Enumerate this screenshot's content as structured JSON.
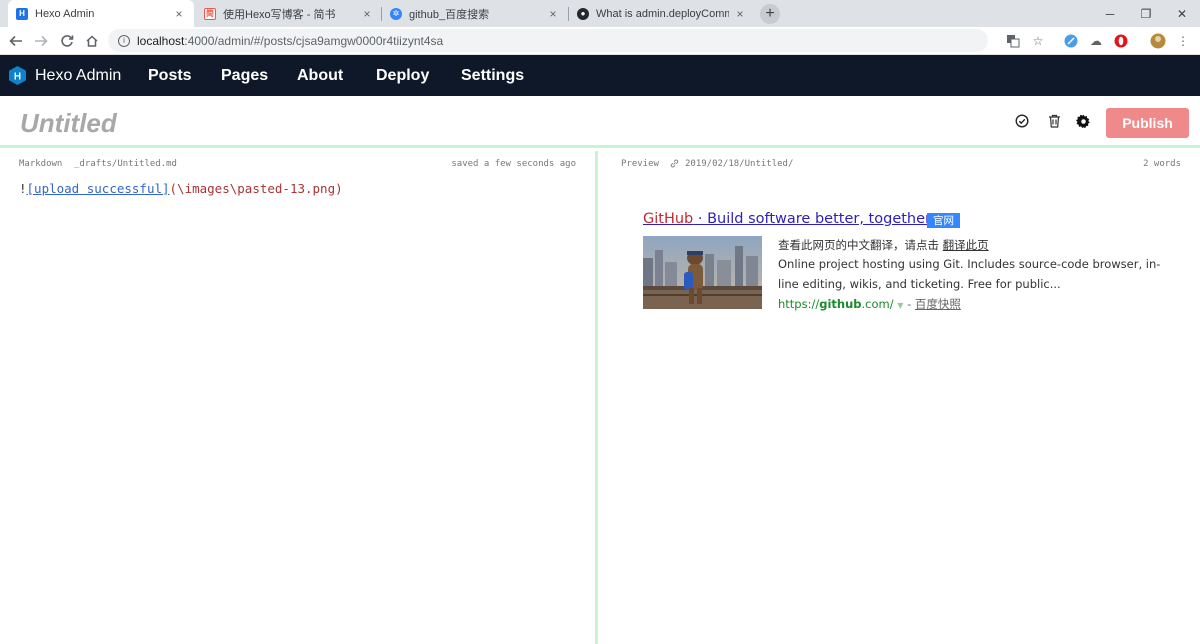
{
  "browser": {
    "tabs": [
      {
        "title": "Hexo Admin",
        "icon": "hexo-favicon-icon",
        "color": "#1e73e8"
      },
      {
        "title": "使用Hexo写博客 - 简书",
        "icon": "jianshu-favicon-icon",
        "color": "#e8594b"
      },
      {
        "title": "github_百度搜索",
        "icon": "baidu-favicon-icon",
        "color": "#3385ff"
      },
      {
        "title": "What is admin.deployComman",
        "icon": "github-favicon-icon",
        "color": "#24292e"
      }
    ],
    "new_tab": "+",
    "close": "×",
    "url_host": "localhost",
    "url_path": ":4000/admin/#/posts/cjsa9amgw0000r4tiizynt4sa"
  },
  "app": {
    "brand": "Hexo Admin",
    "nav": [
      "Posts",
      "Pages",
      "About",
      "Deploy",
      "Settings"
    ],
    "post_title": "Untitled",
    "publish_label": "Publish",
    "accent": "#f08a8a"
  },
  "editor": {
    "mode": "Markdown",
    "file": "_drafts/Untitled.md",
    "saved": "saved a few seconds ago",
    "line_prefix": "!",
    "link_text": "[upload successful]",
    "link_url": "(\\images\\pasted-13.png)"
  },
  "preview": {
    "label": "Preview",
    "path": "2019/02/18/Untitled/",
    "words": "2 words",
    "result": {
      "title_brand": "GitHub",
      "title_rest": " · Build software better, together.",
      "badge": "官网",
      "line1_text": "查看此网页的中文翻译，请点击 ",
      "line1_link": "翻译此页",
      "line2": "Online project hosting using Git. Includes source-code browser, in-",
      "line3": "line editing, wikis, and ticketing. Free for public...",
      "url_prefix": "https://",
      "url_bold": "github",
      "url_suffix": ".com/",
      "url_sep": " - ",
      "snapshot": "百度快照"
    }
  }
}
